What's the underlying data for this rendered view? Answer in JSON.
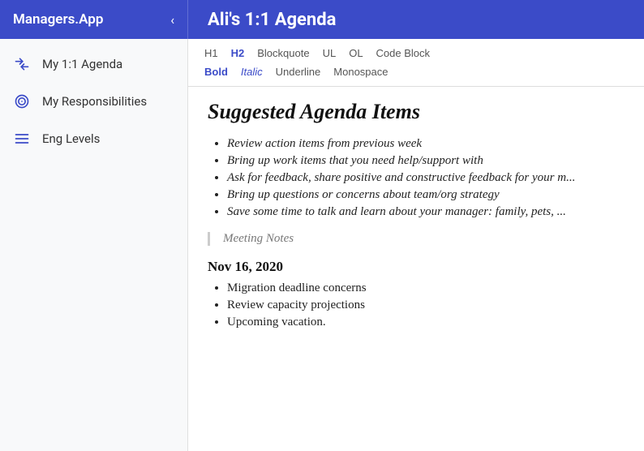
{
  "app": {
    "brand": "Managers.App",
    "chevron": "‹",
    "page_title": "Ali's 1:1 Agenda"
  },
  "sidebar": {
    "items": [
      {
        "id": "my-11-agenda",
        "label": "My 1:1 Agenda",
        "icon": "arrows-icon"
      },
      {
        "id": "my-responsibilities",
        "label": "My Responsibilities",
        "icon": "target-icon"
      },
      {
        "id": "eng-levels",
        "label": "Eng Levels",
        "icon": "list-icon"
      }
    ]
  },
  "toolbar": {
    "row1": {
      "h1": "H1",
      "h2": "H2",
      "blockquote": "Blockquote",
      "ul": "UL",
      "ol": "OL",
      "code_block": "Code Block"
    },
    "row2": {
      "bold": "Bold",
      "italic": "Italic",
      "underline": "Underline",
      "monospace": "Monospace"
    }
  },
  "editor": {
    "suggested_title": "Suggested Agenda Items",
    "bullet_items": [
      "Review action items from previous week",
      "Bring up work items that you need help/support with",
      "Ask for feedback, share positive and constructive feedback for your m...",
      "Bring up questions or concerns about team/org strategy",
      "Save some time to talk and learn about your manager: family, pets, ..."
    ],
    "blockquote_text": "Meeting Notes",
    "meeting_date": "Nov 16, 2020",
    "meeting_notes": [
      "Migration deadline concerns",
      "Review capacity projections",
      "Upcoming vacation."
    ]
  }
}
